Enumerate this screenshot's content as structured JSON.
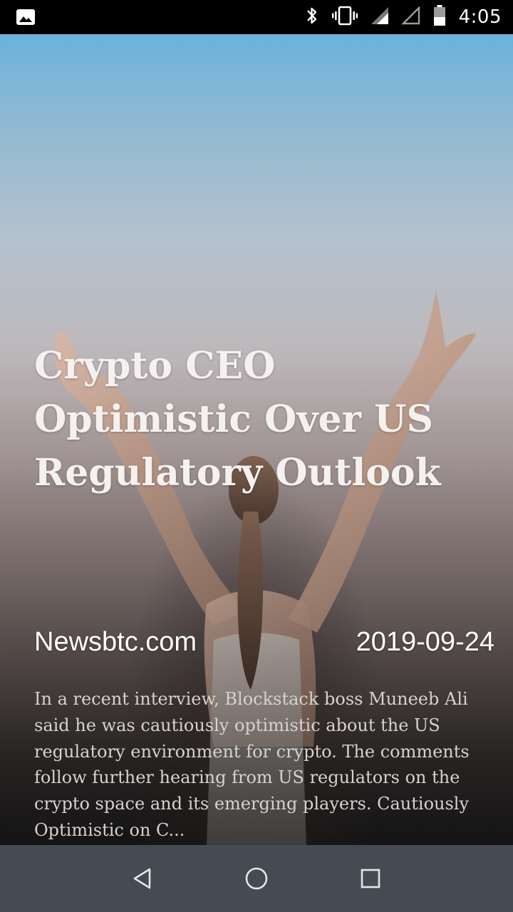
{
  "status_bar": {
    "time": "4:05",
    "icons": [
      "image-notification-icon",
      "bluetooth-icon",
      "vibrate-icon",
      "signal-icon",
      "signal-empty-icon",
      "battery-icon"
    ]
  },
  "article": {
    "headline": "Crypto CEO Optimistic Over US Regulatory Outlook",
    "source": "Newsbtc.com",
    "date": "2019-09-24",
    "summary": "In a recent interview, Blockstack boss Muneeb Ali said he was cautiously optimistic about the US regulatory environment for crypto. The comments follow further hearing from US regulators on the crypto space and its emerging players. Cautiously Optimistic on C..."
  },
  "nav_bar": {
    "icons": [
      "back-icon",
      "home-icon",
      "recents-icon"
    ]
  },
  "colors": {
    "nav_bg": "#454b52",
    "status_bg": "#000000",
    "headline": "#f4f1ef",
    "summary": "#d6d2cf"
  }
}
